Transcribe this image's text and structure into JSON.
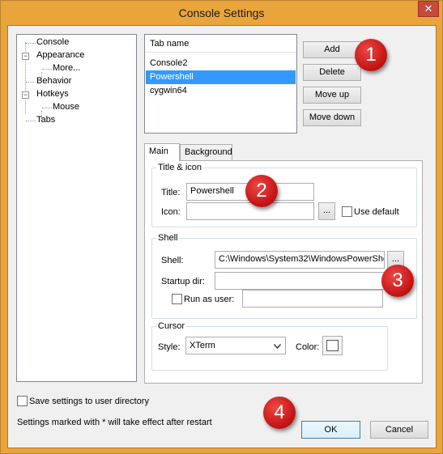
{
  "window": {
    "title": "Console Settings",
    "close_glyph": "✕"
  },
  "tree": {
    "items": [
      {
        "label": "Console"
      },
      {
        "label": "Appearance"
      },
      {
        "label": "More..."
      },
      {
        "label": "Behavior"
      },
      {
        "label": "Hotkeys"
      },
      {
        "label": "Mouse"
      },
      {
        "label": "Tabs"
      }
    ],
    "expander_glyph": "−"
  },
  "tab_list": {
    "header": "Tab name",
    "items": [
      "Console2",
      "Powershell",
      "cygwin64"
    ],
    "selected_index": 1
  },
  "buttons": {
    "add": "Add",
    "delete": "Delete",
    "move_up": "Move up",
    "move_down": "Move down",
    "ok": "OK",
    "cancel": "Cancel"
  },
  "tabs": {
    "main": "Main",
    "background": "Background"
  },
  "title_icon": {
    "group": "Title & icon",
    "title_label": "Title:",
    "title_value": "Powershell",
    "icon_label": "Icon:",
    "icon_value": "",
    "browse_label": "...",
    "use_default_label": "Use default"
  },
  "shell": {
    "group": "Shell",
    "shell_label": "Shell:",
    "shell_value": "C:\\Windows\\System32\\WindowsPowerShe",
    "browse_label": "...",
    "startup_label": "Startup dir:",
    "startup_value": "",
    "run_as_label": "Run as user:",
    "run_as_value": ""
  },
  "cursor": {
    "group": "Cursor",
    "style_label": "Style:",
    "style_value": "XTerm",
    "color_label": "Color:",
    "color_swatch": "#ffffff"
  },
  "footer": {
    "save_label": "Save settings to user directory",
    "restart_note": "Settings marked with * will take effect after restart"
  },
  "markers": [
    "1",
    "2",
    "3",
    "4"
  ],
  "colors": {
    "selection": "#3399ff",
    "marker": "#d01818",
    "title_bar": "#e9a53b"
  }
}
